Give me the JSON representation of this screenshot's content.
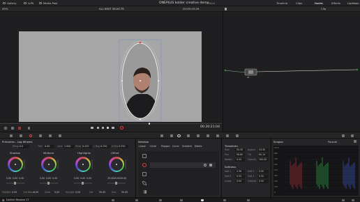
{
  "topbar": {
    "items": [
      "Gallery",
      "LUTs",
      "Media Pool"
    ],
    "project_title": "ONEPLUS kolder creative demo",
    "project_status": "Edited",
    "right_items": [
      "Timeline",
      "Clips",
      "Nodes",
      "Effects",
      "Lightbox"
    ]
  },
  "viewer": {
    "zoom": "49%",
    "clip_name": "ALL BEST SELECTS",
    "timecode": "00:00:19:26",
    "clip_label": "Clip",
    "transport_timecode": "00:30:21:04"
  },
  "palette": {
    "primaries_title": "Primaries - Log Wheels",
    "top_params": [
      {
        "label": "Temp",
        "value": "0.0"
      },
      {
        "label": "Tint",
        "value": "0.00"
      },
      {
        "label": "Cont",
        "value": "1.000"
      },
      {
        "label": "Pivot",
        "value": "0.435"
      },
      {
        "label": "L.Rng",
        "value": "0.250"
      },
      {
        "label": "H.Rng",
        "value": "0.550"
      }
    ],
    "wheels": [
      {
        "name": "Shadow",
        "values": [
          "0.00",
          "0.00",
          "0.00"
        ]
      },
      {
        "name": "Midtone",
        "values": [
          "0.00",
          "0.00",
          "0.00"
        ]
      },
      {
        "name": "Highlights",
        "values": [
          "0.00",
          "0.00",
          "0.00"
        ]
      },
      {
        "name": "Offset",
        "values": [
          "25.00",
          "25.00",
          "25.00"
        ]
      }
    ],
    "bottom_params": [
      {
        "label": "Mid/Det",
        "value": "0.00"
      },
      {
        "label": "Col Boost",
        "value": "0.00"
      },
      {
        "label": "Shad",
        "value": "0.00"
      },
      {
        "label": "Hi/Light",
        "value": "0.00"
      },
      {
        "label": "Sat",
        "value": "50.00"
      },
      {
        "label": "Hue",
        "value": "50.00"
      }
    ]
  },
  "window": {
    "title": "Window",
    "tools": [
      "Linear",
      "Circle",
      "Polygon",
      "Curve",
      "Gradient",
      "Delete"
    ]
  },
  "transform": {
    "title": "Transform",
    "rows": [
      {
        "l1": "Size",
        "v1": "55.30",
        "l2": "Aspect",
        "v2": "23.30"
      },
      {
        "l1": "Pan",
        "v1": "58.80",
        "l2": "Tilt",
        "v2": "60.14"
      },
      {
        "l1": "Rotate",
        "v1": "0.00",
        "l2": "Opacity",
        "v2": "100.00"
      }
    ],
    "softness_title": "Softness",
    "soft_rows": [
      {
        "l1": "Soft 1",
        "v1": "2.36",
        "l2": "Soft 2",
        "v2": "0.50"
      },
      {
        "l1": "Soft 3",
        "v1": "0.50",
        "l2": "Soft 4",
        "v2": "0.50"
      },
      {
        "l1": "Inside",
        "v1": "0.50",
        "l2": "Outside",
        "v2": "0.50"
      }
    ]
  },
  "scopes": {
    "title": "Scopes",
    "mode": "Parade",
    "scale": [
      "1023",
      "896",
      "768",
      "640",
      "512",
      "384",
      "256",
      "128",
      "0"
    ],
    "colors": {
      "red": "#d0303f",
      "green": "#30c050",
      "blue": "#4060e0"
    }
  },
  "status": {
    "app_name": "DaVinci Resolve 17"
  },
  "node": {
    "label": "01"
  },
  "colors": {
    "accent": "#e04040",
    "panel": "#262629"
  }
}
